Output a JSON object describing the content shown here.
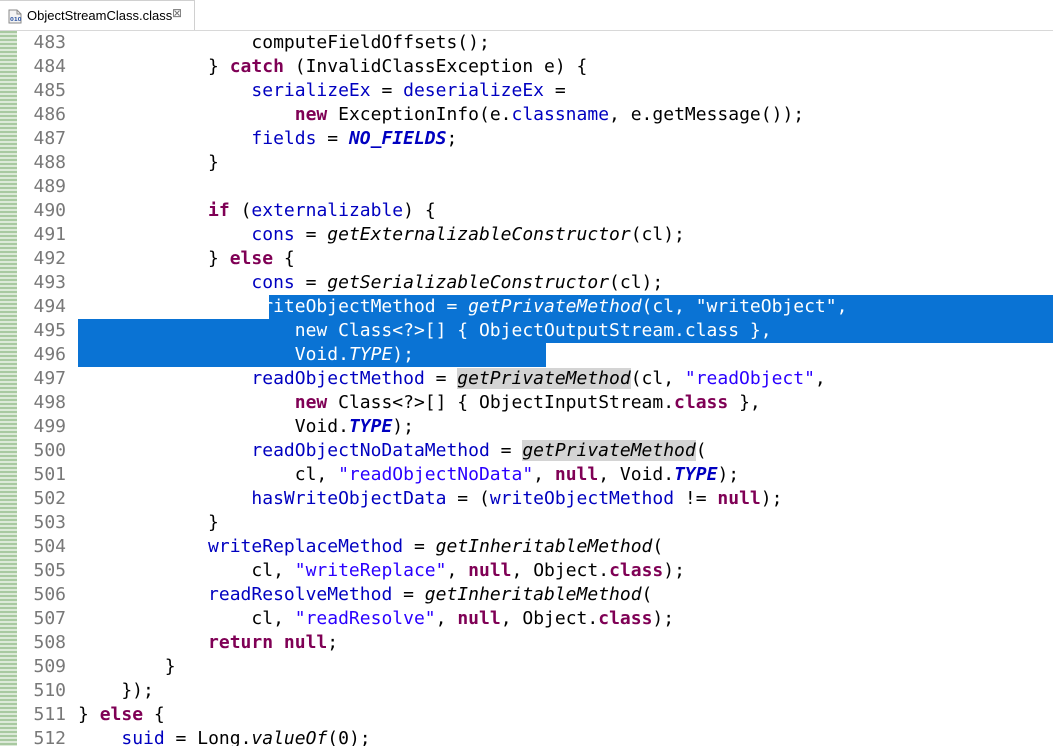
{
  "tab": {
    "title": "ObjectStreamClass.class",
    "icon": "class-file-icon",
    "close": "⊠"
  },
  "lines": [
    {
      "num": "483",
      "tokens": [
        {
          "t": "                computeFieldOffsets();",
          "c": ""
        }
      ]
    },
    {
      "num": "484",
      "tokens": [
        {
          "t": "            } ",
          "c": ""
        },
        {
          "t": "catch",
          "c": "kw"
        },
        {
          "t": " (InvalidClassException e) {",
          "c": ""
        }
      ]
    },
    {
      "num": "485",
      "tokens": [
        {
          "t": "                ",
          "c": ""
        },
        {
          "t": "serializeEx",
          "c": "fld"
        },
        {
          "t": " = ",
          "c": ""
        },
        {
          "t": "deserializeEx",
          "c": "fld"
        },
        {
          "t": " =",
          "c": ""
        }
      ]
    },
    {
      "num": "486",
      "tokens": [
        {
          "t": "                    ",
          "c": ""
        },
        {
          "t": "new",
          "c": "kw"
        },
        {
          "t": " ExceptionInfo(e.",
          "c": ""
        },
        {
          "t": "classname",
          "c": "fld"
        },
        {
          "t": ", e.getMessage());",
          "c": ""
        }
      ]
    },
    {
      "num": "487",
      "tokens": [
        {
          "t": "                ",
          "c": ""
        },
        {
          "t": "fields",
          "c": "fld"
        },
        {
          "t": " = ",
          "c": ""
        },
        {
          "t": "NO_FIELDS",
          "c": "sfld"
        },
        {
          "t": ";",
          "c": ""
        }
      ]
    },
    {
      "num": "488",
      "tokens": [
        {
          "t": "            }",
          "c": ""
        }
      ]
    },
    {
      "num": "489",
      "tokens": []
    },
    {
      "num": "490",
      "tokens": [
        {
          "t": "            ",
          "c": ""
        },
        {
          "t": "if",
          "c": "kw"
        },
        {
          "t": " (",
          "c": ""
        },
        {
          "t": "externalizable",
          "c": "fld"
        },
        {
          "t": ") {",
          "c": ""
        }
      ]
    },
    {
      "num": "491",
      "tokens": [
        {
          "t": "                ",
          "c": ""
        },
        {
          "t": "cons",
          "c": "fld"
        },
        {
          "t": " = ",
          "c": ""
        },
        {
          "t": "getExternalizableConstructor",
          "c": "sm"
        },
        {
          "t": "(cl);",
          "c": ""
        }
      ]
    },
    {
      "num": "492",
      "tokens": [
        {
          "t": "            } ",
          "c": ""
        },
        {
          "t": "else",
          "c": "kw"
        },
        {
          "t": " {",
          "c": ""
        }
      ]
    },
    {
      "num": "493",
      "tokens": [
        {
          "t": "                ",
          "c": ""
        },
        {
          "t": "cons",
          "c": "fld"
        },
        {
          "t": " = ",
          "c": ""
        },
        {
          "t": "getSerializableConstructor",
          "c": "sm"
        },
        {
          "t": "(cl);",
          "c": ""
        }
      ]
    },
    {
      "num": "494",
      "tokens": [
        {
          "t": "                writeObjectMethod = ",
          "c": ""
        },
        {
          "t": "getPrivateMethod",
          "c": "sm"
        },
        {
          "t": "(cl, \"writeObject\",",
          "c": ""
        }
      ]
    },
    {
      "num": "495",
      "tokens": [
        {
          "t": "                    new Class<?>[] { ObjectOutputStream.class },",
          "c": ""
        }
      ]
    },
    {
      "num": "496",
      "tokens": [
        {
          "t": "                    Void.",
          "c": ""
        },
        {
          "t": "TYPE",
          "c": "sm"
        },
        {
          "t": ");",
          "c": ""
        }
      ]
    },
    {
      "num": "497",
      "tokens": [
        {
          "t": "                ",
          "c": ""
        },
        {
          "t": "readObjectMethod",
          "c": "fld"
        },
        {
          "t": " = ",
          "c": ""
        },
        {
          "t": "getPrivateMethod",
          "c": "sm hl"
        },
        {
          "t": "(cl, ",
          "c": ""
        },
        {
          "t": "\"readObject\"",
          "c": "str"
        },
        {
          "t": ",",
          "c": ""
        }
      ]
    },
    {
      "num": "498",
      "tokens": [
        {
          "t": "                    ",
          "c": ""
        },
        {
          "t": "new",
          "c": "kw"
        },
        {
          "t": " Class<?>[] { ObjectInputStream.",
          "c": ""
        },
        {
          "t": "class",
          "c": "kw"
        },
        {
          "t": " },",
          "c": ""
        }
      ]
    },
    {
      "num": "499",
      "tokens": [
        {
          "t": "                    Void.",
          "c": ""
        },
        {
          "t": "TYPE",
          "c": "sfld"
        },
        {
          "t": ");",
          "c": ""
        }
      ]
    },
    {
      "num": "500",
      "tokens": [
        {
          "t": "                ",
          "c": ""
        },
        {
          "t": "readObjectNoDataMethod",
          "c": "fld"
        },
        {
          "t": " = ",
          "c": ""
        },
        {
          "t": "getPrivateMethod",
          "c": "sm hl"
        },
        {
          "t": "(",
          "c": ""
        }
      ]
    },
    {
      "num": "501",
      "tokens": [
        {
          "t": "                    cl, ",
          "c": ""
        },
        {
          "t": "\"readObjectNoData\"",
          "c": "str"
        },
        {
          "t": ", ",
          "c": ""
        },
        {
          "t": "null",
          "c": "kw"
        },
        {
          "t": ", Void.",
          "c": ""
        },
        {
          "t": "TYPE",
          "c": "sfld"
        },
        {
          "t": ");",
          "c": ""
        }
      ]
    },
    {
      "num": "502",
      "tokens": [
        {
          "t": "                ",
          "c": ""
        },
        {
          "t": "hasWriteObjectData",
          "c": "fld"
        },
        {
          "t": " = (",
          "c": ""
        },
        {
          "t": "writeObjectMethod",
          "c": "fld"
        },
        {
          "t": " != ",
          "c": ""
        },
        {
          "t": "null",
          "c": "kw"
        },
        {
          "t": ");",
          "c": ""
        }
      ]
    },
    {
      "num": "503",
      "tokens": [
        {
          "t": "            }",
          "c": ""
        }
      ]
    },
    {
      "num": "504",
      "tokens": [
        {
          "t": "            ",
          "c": ""
        },
        {
          "t": "writeReplaceMethod",
          "c": "fld"
        },
        {
          "t": " = ",
          "c": ""
        },
        {
          "t": "getInheritableMethod",
          "c": "sm"
        },
        {
          "t": "(",
          "c": ""
        }
      ]
    },
    {
      "num": "505",
      "tokens": [
        {
          "t": "                cl, ",
          "c": ""
        },
        {
          "t": "\"writeReplace\"",
          "c": "str"
        },
        {
          "t": ", ",
          "c": ""
        },
        {
          "t": "null",
          "c": "kw"
        },
        {
          "t": ", Object.",
          "c": ""
        },
        {
          "t": "class",
          "c": "kw"
        },
        {
          "t": ");",
          "c": ""
        }
      ]
    },
    {
      "num": "506",
      "tokens": [
        {
          "t": "            ",
          "c": ""
        },
        {
          "t": "readResolveMethod",
          "c": "fld"
        },
        {
          "t": " = ",
          "c": ""
        },
        {
          "t": "getInheritableMethod",
          "c": "sm"
        },
        {
          "t": "(",
          "c": ""
        }
      ]
    },
    {
      "num": "507",
      "tokens": [
        {
          "t": "                cl, ",
          "c": ""
        },
        {
          "t": "\"readResolve\"",
          "c": "str"
        },
        {
          "t": ", ",
          "c": ""
        },
        {
          "t": "null",
          "c": "kw"
        },
        {
          "t": ", Object.",
          "c": ""
        },
        {
          "t": "class",
          "c": "kw"
        },
        {
          "t": ");",
          "c": ""
        }
      ]
    },
    {
      "num": "508",
      "tokens": [
        {
          "t": "            ",
          "c": ""
        },
        {
          "t": "return",
          "c": "kw"
        },
        {
          "t": " ",
          "c": ""
        },
        {
          "t": "null",
          "c": "kw"
        },
        {
          "t": ";",
          "c": ""
        }
      ]
    },
    {
      "num": "509",
      "tokens": [
        {
          "t": "        }",
          "c": ""
        }
      ]
    },
    {
      "num": "510",
      "tokens": [
        {
          "t": "    });",
          "c": ""
        }
      ]
    },
    {
      "num": "511",
      "tokens": [
        {
          "t": "} ",
          "c": ""
        },
        {
          "t": "else",
          "c": "kw"
        },
        {
          "t": " {",
          "c": ""
        }
      ]
    },
    {
      "num": "512",
      "tokens": [
        {
          "t": "    ",
          "c": ""
        },
        {
          "t": "suid",
          "c": "fld"
        },
        {
          "t": " = Long.",
          "c": ""
        },
        {
          "t": "valueOf",
          "c": "sm"
        },
        {
          "t": "(0);",
          "c": ""
        }
      ]
    }
  ]
}
